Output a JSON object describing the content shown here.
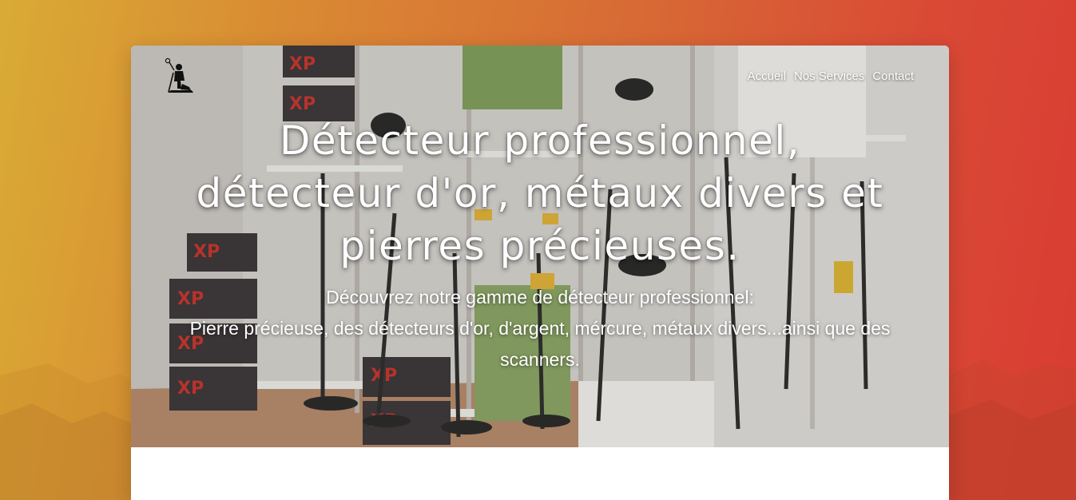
{
  "nav": {
    "items": [
      "Accueil",
      "Nos Services",
      "Contact"
    ]
  },
  "hero": {
    "title": "Détecteur professionnel, détecteur d'or, métaux divers et pierres précieuses.",
    "subtitle_line1": "Découvrez notre gamme de détecteur professionnel:",
    "subtitle_line2": "Pierre précieuse, des détecteurs d'or, d'argent, mércure, métaux divers...ainsi que des scanners."
  },
  "logo": {
    "icon": "prospector-silhouette-icon"
  },
  "colors": {
    "background_start": "#d9ab35",
    "background_end": "#d93c32",
    "card": "#ffffff",
    "hero_text": "#ffffff"
  }
}
